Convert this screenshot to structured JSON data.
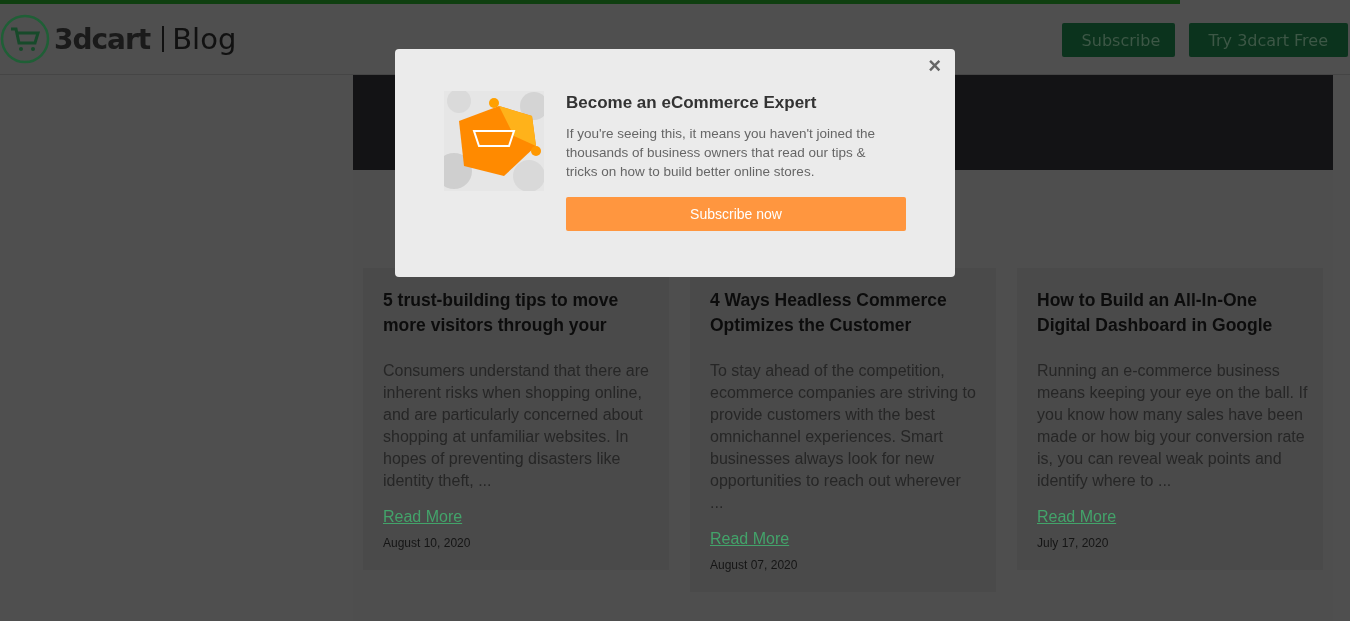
{
  "header": {
    "logo": "3dcart",
    "section": "Blog",
    "buttons": [
      "Subscribe",
      "Try 3dcart Free"
    ]
  },
  "posts": [
    {
      "title": "5 trust-building tips to move more visitors through your",
      "excerpt": "Consumers understand that there are inherent risks when shopping online, and are particularly concerned about shopping at unfamiliar websites. In hopes of preventing disasters like identity theft, ...",
      "link": "Read More",
      "date": "August 10, 2020"
    },
    {
      "title": "4 Ways Headless Commerce Optimizes the Customer",
      "excerpt": "To stay ahead of the competition, ecommerce companies are striving to provide customers with the best omnichannel experiences. Smart businesses always look for new opportunities to reach out wherever ...",
      "link": "Read More",
      "date": "August 07, 2020"
    },
    {
      "title": "How to Build an All-In-One Digital Dashboard in Google",
      "excerpt": "Running an e-commerce business means keeping your eye on the ball. If you know how many sales have been made or how big your conversion rate is, you can reveal weak points and identify where to ...",
      "link": "Read More",
      "date": "July 17, 2020"
    }
  ],
  "popup": {
    "close": "×",
    "title": "Become an eCommerce Expert",
    "text": "If you're seeing this, it means you haven't joined the thousands of business owners that read our tips & tricks on how to build better online stores.",
    "button": "Subscribe now"
  }
}
